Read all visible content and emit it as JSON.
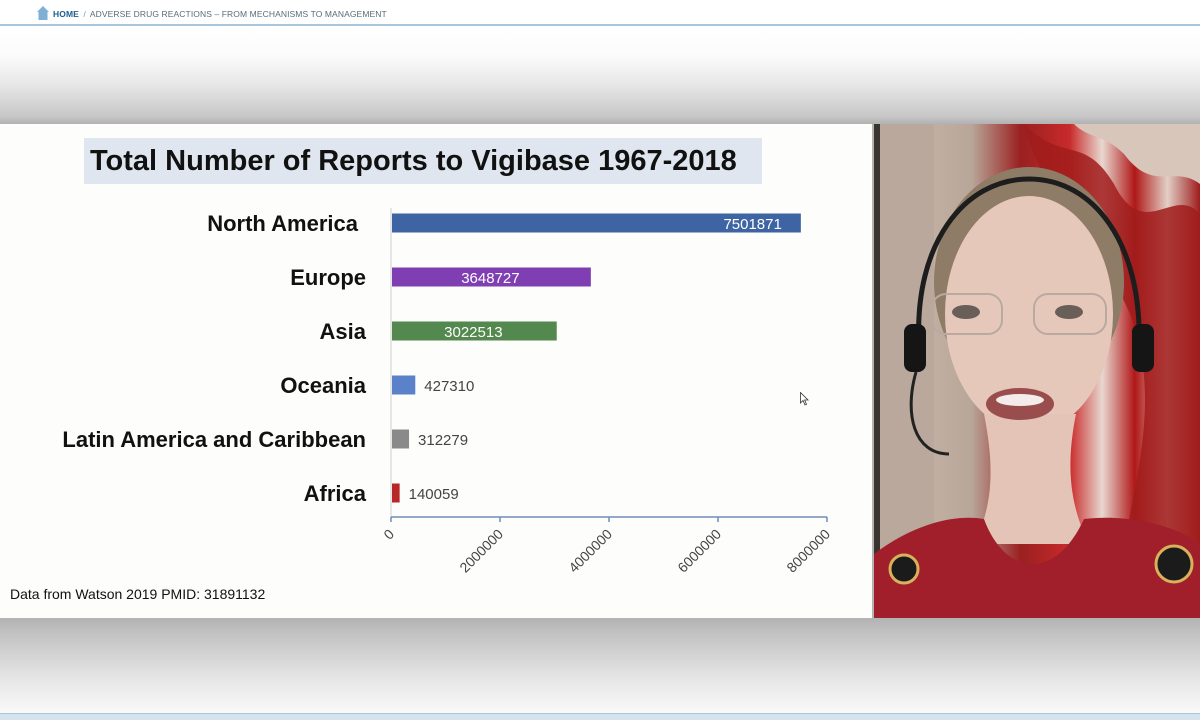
{
  "breadcrumb": {
    "home_label": "HOME",
    "separator": "/",
    "current": "ADVERSE DRUG REACTIONS – FROM MECHANISMS TO MANAGEMENT"
  },
  "slide": {
    "title": "Total Number of Reports to Vigibase 1967-2018",
    "source_note": "Data from Watson 2019 PMID: 31891132"
  },
  "chart_data": {
    "type": "bar",
    "orientation": "horizontal",
    "title": "Total Number of Reports to Vigibase 1967-2018",
    "categories": [
      "North America",
      "Europe",
      "Asia",
      "Oceania",
      "Latin America and Caribbean",
      "Africa"
    ],
    "values": [
      7501871,
      3648727,
      3022513,
      427310,
      312279,
      140059
    ],
    "value_labels": [
      "7501871",
      "3648727",
      "3022513",
      "427310",
      "312279",
      "140059"
    ],
    "bar_colors": [
      "#3f64a3",
      "#7f3fb3",
      "#53884e",
      "#5b82c8",
      "#8a8a8a",
      "#b92626"
    ],
    "xlim": [
      0,
      8000000
    ],
    "xticks": [
      "0",
      "2000000",
      "4000000",
      "6000000",
      "8000000"
    ],
    "label_inside": [
      true,
      true,
      true,
      false,
      false,
      false
    ],
    "grid": false,
    "legend": "none"
  },
  "icons": {
    "home": "home-icon",
    "cursor": "mouse-pointer-icon"
  }
}
